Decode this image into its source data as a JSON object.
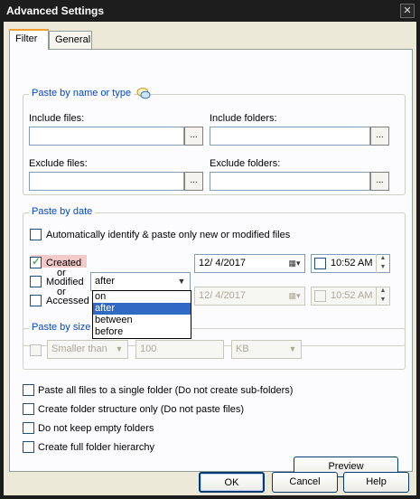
{
  "window": {
    "title": "Advanced Settings",
    "close_glyph": "✕"
  },
  "tabs": [
    {
      "label": "Filter"
    },
    {
      "label": "General"
    }
  ],
  "paste_by_name": {
    "title": "Paste by name or type",
    "include_files_label": "Include files:",
    "include_folders_label": "Include folders:",
    "exclude_files_label": "Exclude files:",
    "exclude_folders_label": "Exclude folders:",
    "browse_label": "..."
  },
  "paste_by_date": {
    "title": "Paste by date",
    "auto_identify_label": "Automatically identify & paste only new or modified files",
    "created_label": "Created",
    "or1": "or",
    "modified_label": "Modified",
    "or2": "or",
    "accessed_label": "Accessed",
    "condition_value": "after",
    "condition_options": [
      "on",
      "after",
      "between",
      "before"
    ],
    "date1": "12/  4/2017",
    "time1": "10:52 AM",
    "date2": "12/  4/2017",
    "time2": "10:52 AM"
  },
  "paste_by_size": {
    "title": "Paste by size",
    "comparison": "Smaller than",
    "size_value": "100",
    "unit": "KB"
  },
  "options": [
    "Paste all files to a single folder (Do not create sub-folders)",
    "Create folder structure only (Do not paste files)",
    "Do not keep empty folders",
    "Create full folder hierarchy"
  ],
  "buttons": {
    "preview": "Preview",
    "ok": "OK",
    "cancel": "Cancel",
    "help": "Help"
  }
}
